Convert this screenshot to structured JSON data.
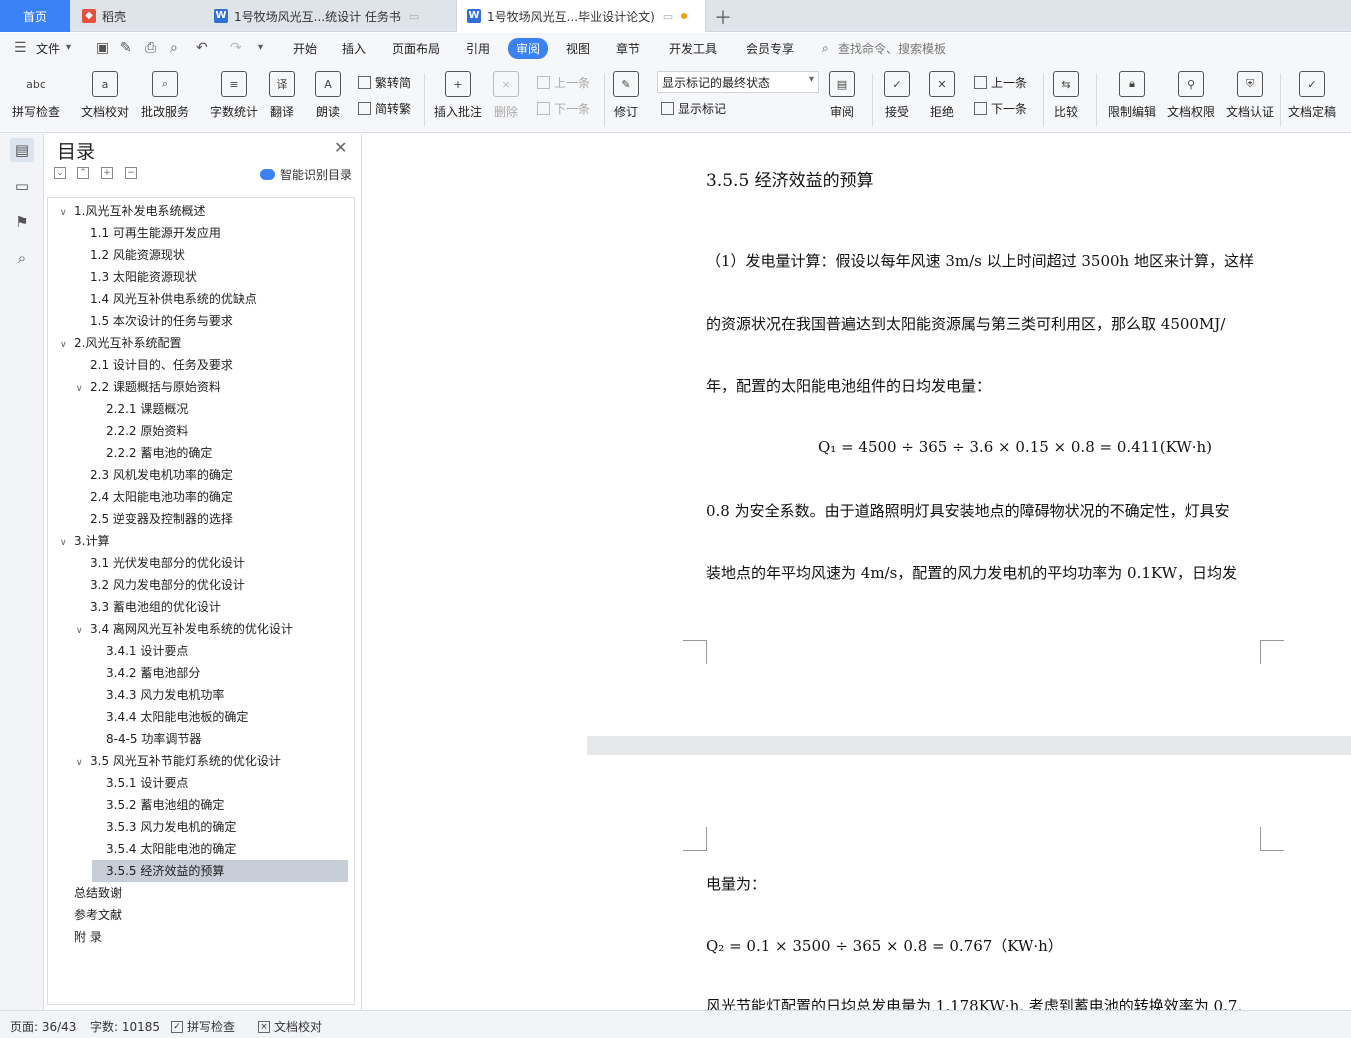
{
  "tabs": {
    "home": "首页",
    "daoke": "稻壳",
    "doc1": "1号牧场风光互...统设计 任务书",
    "doc2": "1号牧场风光互...毕业设计论文)"
  },
  "menu": {
    "file": "文件",
    "items": [
      "开始",
      "插入",
      "页面布局",
      "引用",
      "审阅",
      "视图",
      "章节",
      "开发工具",
      "会员专享"
    ],
    "search": "查找命令、搜索模板"
  },
  "ribbon": {
    "spell": "拼写检查",
    "doccheck": "文档校对",
    "annotate_service": "批改服务",
    "wordcount": "字数统计",
    "translate": "翻译",
    "read": "朗读",
    "trad": "繁转简",
    "simp": "简转繁",
    "insert_comment": "插入批注",
    "delete": "删除",
    "prev": "上一条",
    "next": "下一条",
    "revise": "修订",
    "markup_select": "显示标记的最终状态",
    "show_markup": "显示标记",
    "review": "审阅",
    "accept": "接受",
    "reject": "拒绝",
    "prev2": "上一条",
    "next2": "下一条",
    "compare": "比较",
    "restrict": "限制编辑",
    "rights": "文档权限",
    "certify": "文档认证",
    "finalize": "文档定稿"
  },
  "toc": {
    "title": "目录",
    "smart": "智能识别目录",
    "items": [
      "1.风光互补发电系统概述",
      "1.1  可再生能源开发应用",
      "1.2  风能资源现状",
      "1.3  太阳能资源现状",
      "1.4  风光互补供电系统的优缺点",
      "1.5 本次设计的任务与要求",
      "2.风光互补系统配置",
      "2.1 设计目的、任务及要求",
      "2.2 课题概括与原始资料",
      "2.2.1 课题概况",
      "2.2.2 原始资料",
      "2.2.2 蓄电池的确定",
      "2.3 风机发电机功率的确定",
      "2.4 太阳能电池功率的确定",
      "2.5 逆变器及控制器的选择",
      "3.计算",
      "3.1 光伏发电部分的优化设计",
      "3.2 风力发电部分的优化设计",
      "3.3 蓄电池组的优化设计",
      "3.4  离网风光互补发电系统的优化设计",
      "3.4.1 设计要点",
      "3.4.2 蓄电池部分",
      "3.4.3 风力发电机功率",
      "3.4.4 太阳能电池板的确定",
      "8-4-5 功率调节器",
      "3.5  风光互补节能灯系统的优化设计",
      "3.5.1 设计要点",
      "3.5.2 蓄电池组的确定",
      "3.5.3 风力发电机的确定",
      "3.5.4 太阳能电池的确定",
      "3.5.5 经济效益的预算",
      "总结致谢",
      "参考文献",
      "附  录"
    ]
  },
  "doc": {
    "heading": "3.5.5 经济效益的预算",
    "p1": "（1）发电量计算：假设以每年风速 3m/s 以上时间超过 3500h 地区来计算，这样",
    "p2": "的资源状况在我国普遍达到太阳能资源属与第三类可利用区，那么取 4500MJ/",
    "p3": "年，配置的太阳能电池组件的日均发电量：",
    "eq1": "Q₁ = 4500 ÷ 365 ÷ 3.6 × 0.15 × 0.8 = 0.411(KW·h)",
    "p4": "0.8 为安全系数。由于道路照明灯具安装地点的障碍物状况的不确定性，灯具安",
    "p5": "装地点的年平均风速为 4m/s，配置的风力发电机的平均功率为 0.1KW，日均发",
    "p6": "电量为：",
    "eq2": "Q₂ = 0.1 × 3500 ÷ 365 × 0.8 = 0.767（KW·h）",
    "p7": "风光节能灯配置的日均总发电量为 1.178KW·h, 考虑到蓄电池的转换效率为 0.7,"
  },
  "status": {
    "page": "页面: 36/43",
    "words": "字数: 10185",
    "spell": "拼写检查",
    "proof": "文档校对"
  },
  "colors": {
    "accent": "#3b82f6",
    "selected_toc": "#c8ced8"
  }
}
